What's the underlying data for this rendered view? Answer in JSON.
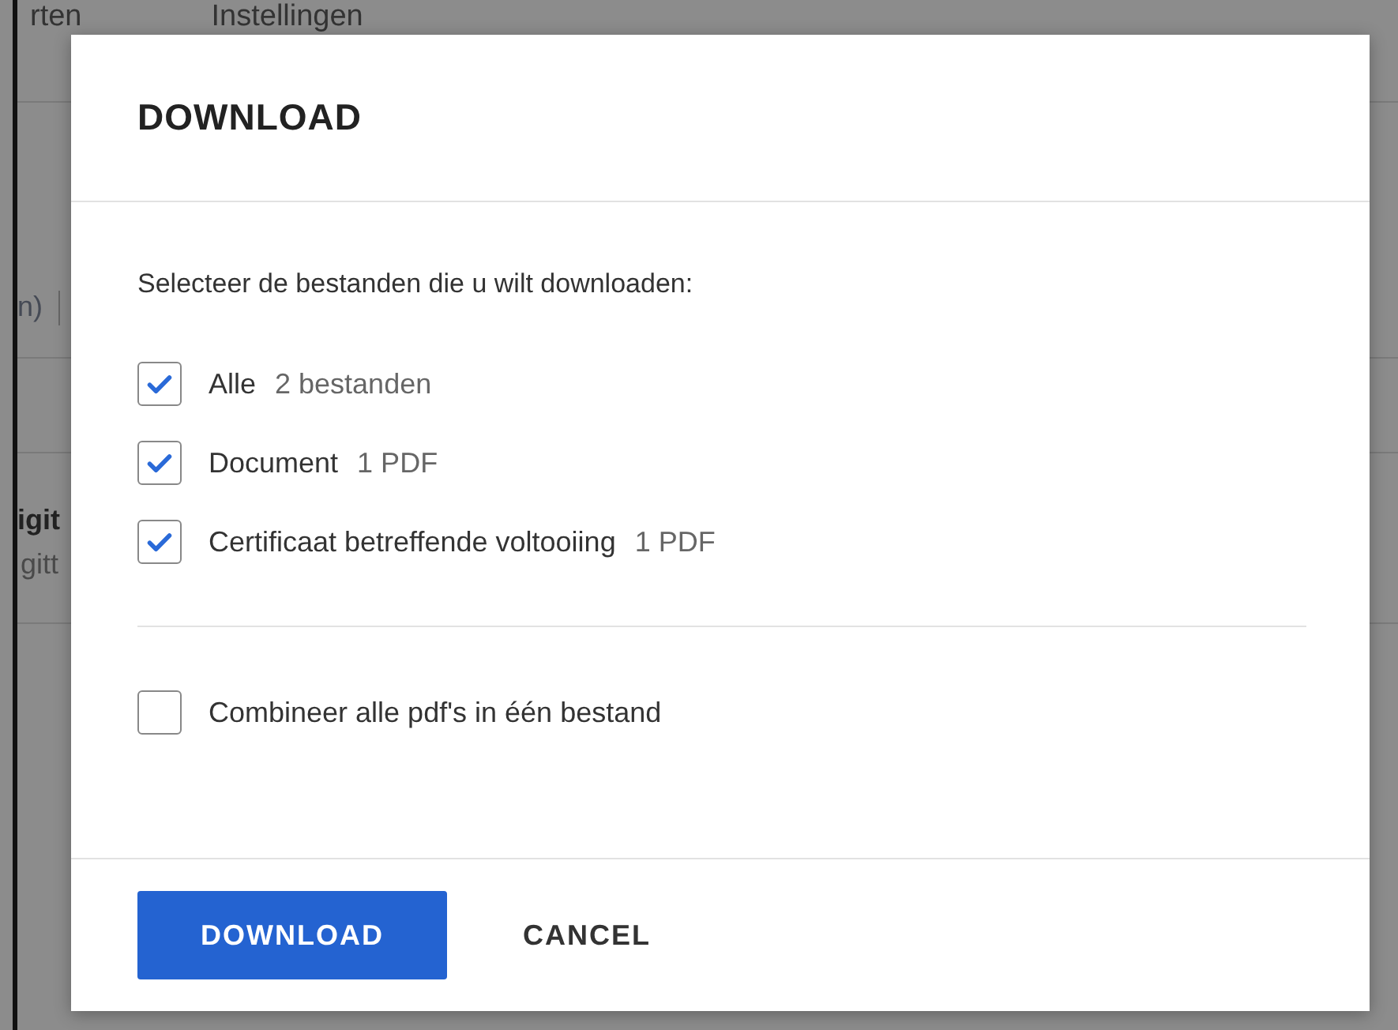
{
  "background": {
    "tabs": [
      "rten",
      "Instellingen"
    ],
    "fragments": [
      "n)",
      "igit",
      "gitt"
    ]
  },
  "dialog": {
    "title": "DOWNLOAD",
    "prompt": "Selecteer de bestanden die u wilt downloaden:",
    "files": [
      {
        "label": "Alle",
        "detail": "2 bestanden",
        "checked": true
      },
      {
        "label": "Document",
        "detail": "1 PDF",
        "checked": true
      },
      {
        "label": "Certificaat betreffende voltooiing",
        "detail": "1 PDF",
        "checked": true
      }
    ],
    "combine": {
      "label": "Combineer alle pdf's in één bestand",
      "checked": false
    },
    "buttons": [
      {
        "label": "DOWNLOAD",
        "kind": "primary"
      },
      {
        "label": "CANCEL",
        "kind": "text"
      }
    ]
  }
}
